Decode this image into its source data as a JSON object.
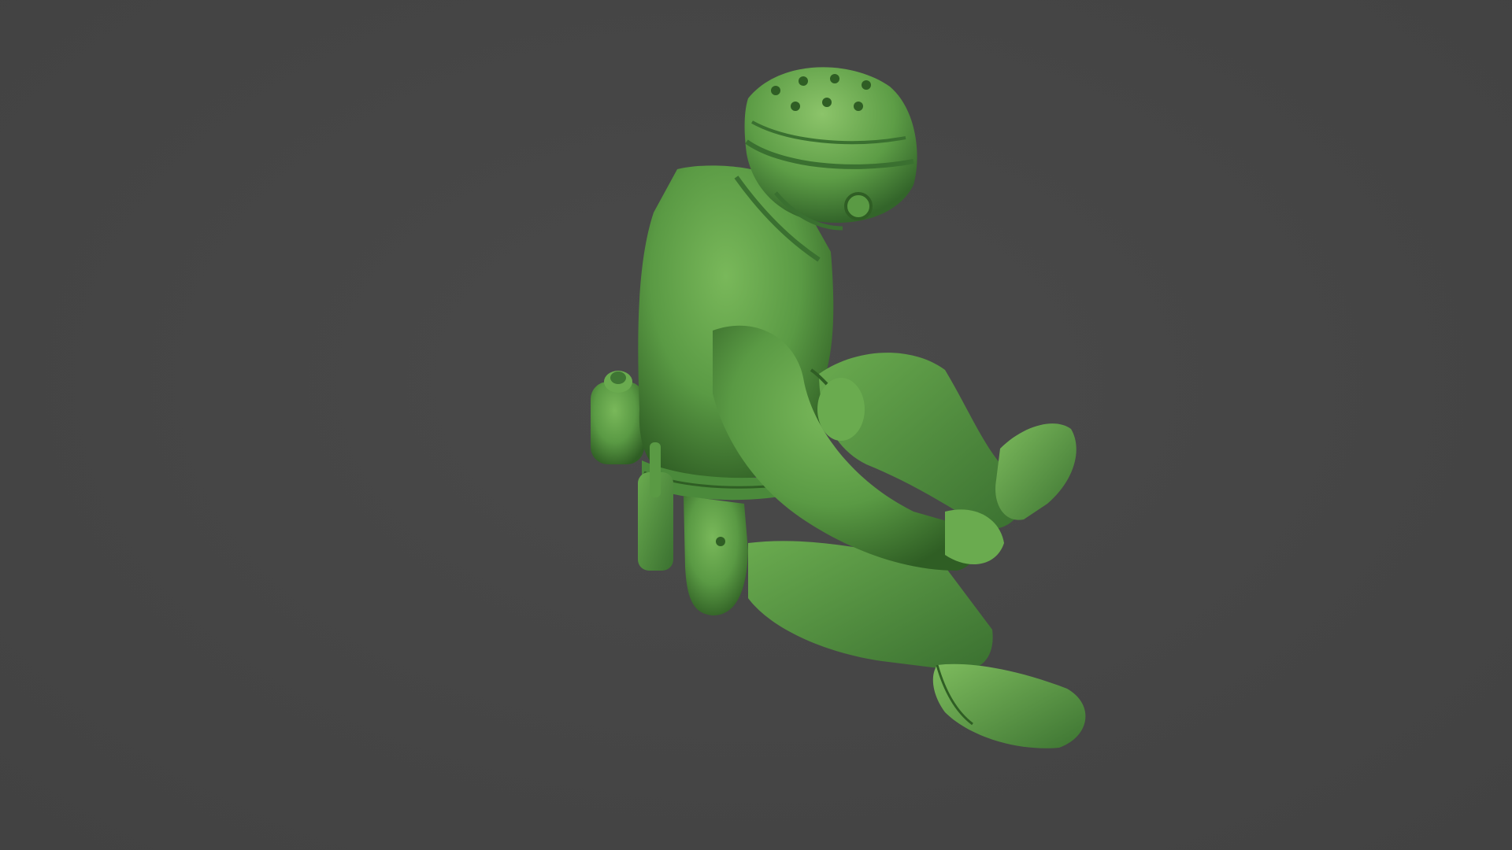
{
  "scene": {
    "background_color": "#474747",
    "model_color": "#5a9a44",
    "model_shadow_color": "#2f5e24",
    "model_highlight_color": "#8cc46a",
    "subject": "seated-toy-soldier-figure"
  }
}
